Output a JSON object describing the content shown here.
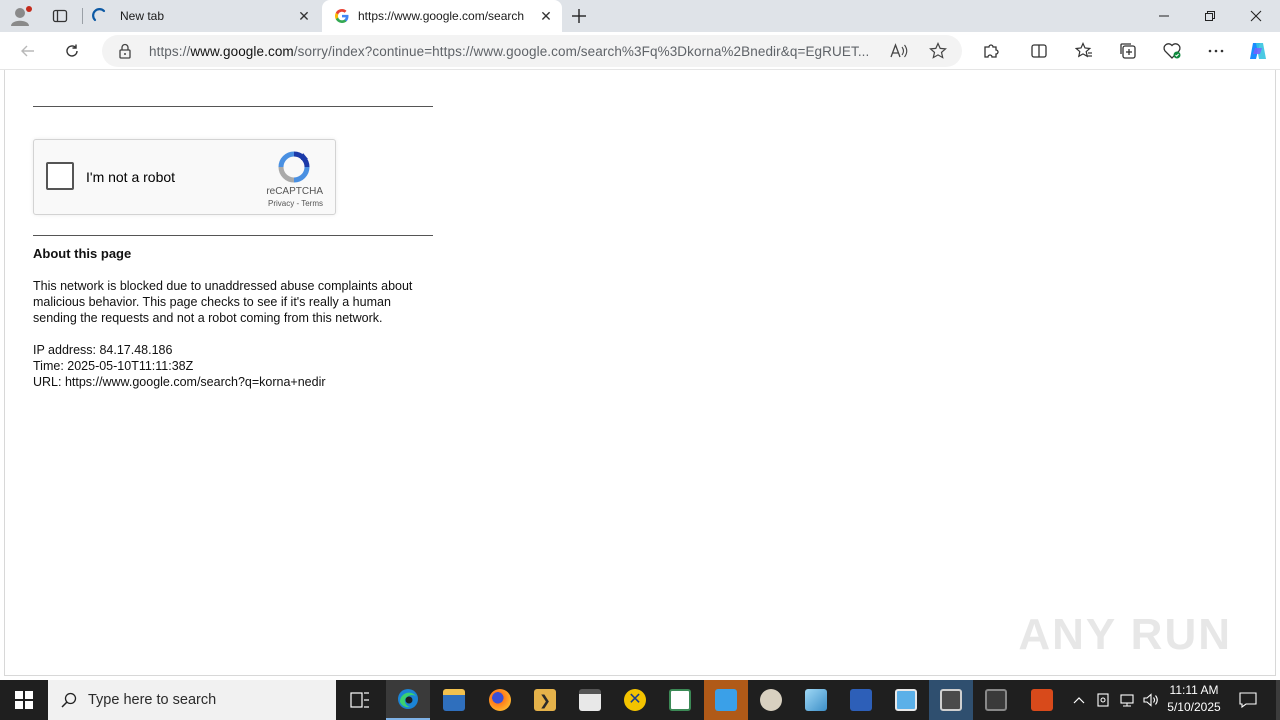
{
  "browser": {
    "tabs": [
      {
        "title": "New tab"
      },
      {
        "title": "https://www.google.com/search"
      }
    ],
    "address": {
      "prefix": "https://",
      "host": "www.google.com",
      "path": "/sorry/index?continue=https://www.google.com/search%3Fq%3Dkorna%2Bnedir&q=EgRUET..."
    }
  },
  "page": {
    "captcha": {
      "label": "I'm not a robot",
      "brand": "reCAPTCHA",
      "privacy": "Privacy",
      "separator": " - ",
      "terms": "Terms"
    },
    "about_heading": "About this page",
    "about_text": "This network is blocked due to unaddressed abuse complaints about malicious behavior. This page checks to see if it's really a human sending the requests and not a robot coming from this network.",
    "ip_line": "IP address: 84.17.48.186",
    "time_line": "Time: 2025-05-10T11:11:38Z",
    "url_line": "URL: https://www.google.com/search?q=korna+nedir"
  },
  "watermark": "ANY RUN",
  "taskbar": {
    "search_placeholder": "Type here to search",
    "time": "11:11 AM",
    "date": "5/10/2025"
  },
  "colors": {
    "accent_blue": "#0078d4",
    "recaptcha_blue": "#4a90e2",
    "taskbar": "#1f1f1f"
  }
}
